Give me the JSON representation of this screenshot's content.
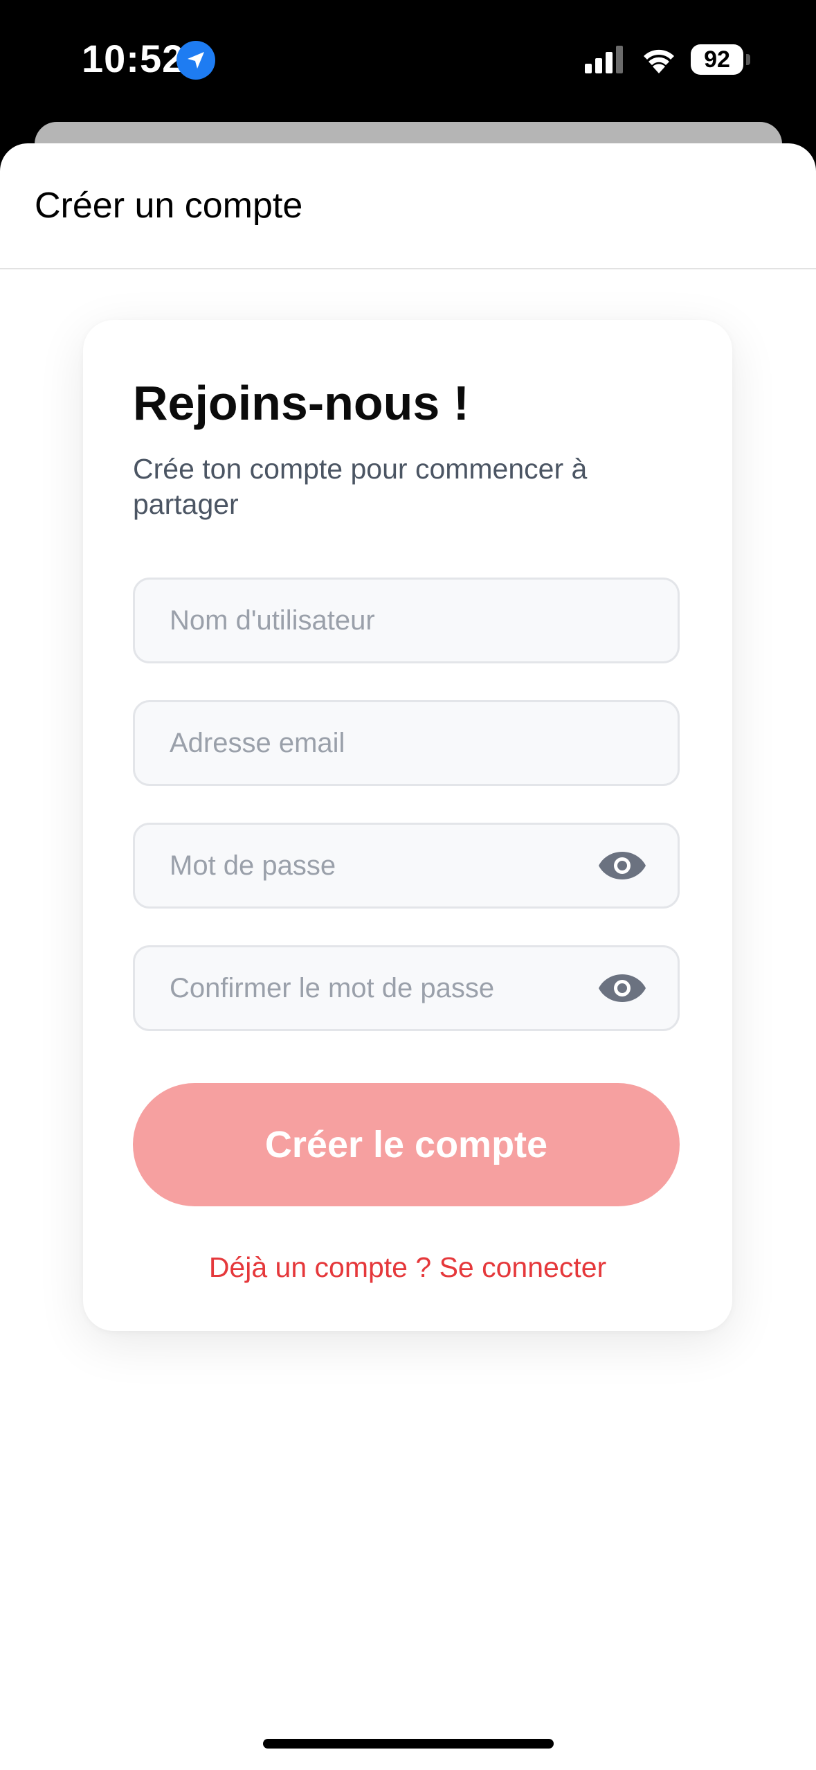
{
  "status_bar": {
    "time": "10:52",
    "battery": "92",
    "icons": [
      "location-arrow-icon",
      "cellular-signal-icon",
      "wifi-icon",
      "battery-icon"
    ]
  },
  "nav": {
    "title": "Créer un compte"
  },
  "card": {
    "title": "Rejoins-nous !",
    "subtitle": "Crée ton compte pour commencer à partager"
  },
  "form": {
    "username": {
      "value": "",
      "placeholder": "Nom d'utilisateur"
    },
    "email": {
      "value": "",
      "placeholder": "Adresse email"
    },
    "password": {
      "value": "",
      "placeholder": "Mot de passe",
      "toggle_icon": "eye-icon"
    },
    "confirm_password": {
      "value": "",
      "placeholder": "Confirmer le mot de passe",
      "toggle_icon": "eye-icon"
    },
    "submit_label": "Créer le compte",
    "login_link": "Déjà un compte ? Se connecter"
  },
  "colors": {
    "accent": "#e5383b",
    "button_disabled": "#f6a0a0",
    "field_bg": "#f8f9fb",
    "field_border": "#e3e5e9",
    "placeholder": "#9aa0aa",
    "location_blue": "#1e7cf2"
  }
}
